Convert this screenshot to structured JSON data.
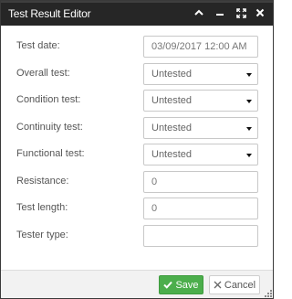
{
  "window": {
    "title": "Test Result Editor"
  },
  "form": {
    "test_date": {
      "label": "Test date:",
      "value": "03/09/2017 12:00 AM"
    },
    "overall_test": {
      "label": "Overall test:",
      "value": "Untested"
    },
    "condition_test": {
      "label": "Condition test:",
      "value": "Untested"
    },
    "continuity_test": {
      "label": "Continuity test:",
      "value": "Untested"
    },
    "functional_test": {
      "label": "Functional test:",
      "value": "Untested"
    },
    "resistance": {
      "label": "Resistance:",
      "value": "0"
    },
    "test_length": {
      "label": "Test length:",
      "value": "0"
    },
    "tester_type": {
      "label": "Tester type:",
      "value": ""
    }
  },
  "footer": {
    "save_label": "Save",
    "cancel_label": "Cancel"
  },
  "colors": {
    "titlebar": "#262626",
    "save_button": "#4cae4c",
    "footer": "#f2f2f2"
  },
  "icons": [
    "chevron-up-icon",
    "minimize-icon",
    "maximize-icon",
    "close-icon",
    "checkmark-icon",
    "x-icon",
    "caret-down-icon",
    "resize-grip-icon"
  ]
}
